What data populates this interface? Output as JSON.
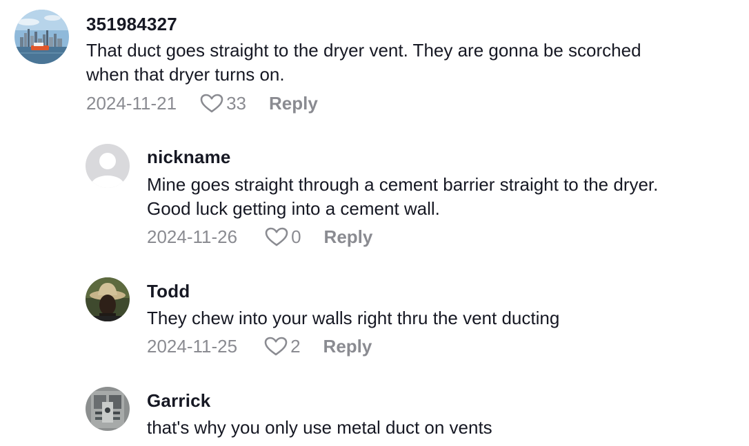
{
  "comments": [
    {
      "username": "351984327",
      "text_lines": [
        "That duct goes straight to the dryer vent. They are gonna be scorched",
        "when that dryer turns on."
      ],
      "date": "2024-11-21",
      "likes": "33",
      "reply_label": "Reply",
      "avatar": "city-skyline-photo"
    },
    {
      "username": "nickname",
      "text_lines": [
        "Mine goes straight through a cement barrier straight to the dryer.",
        "Good luck getting into a cement wall."
      ],
      "date": "2024-11-26",
      "likes": "0",
      "reply_label": "Reply",
      "avatar": "default-user-placeholder"
    },
    {
      "username": "Todd",
      "text_lines": [
        "They chew into your walls right thru the vent ducting"
      ],
      "date": "2024-11-25",
      "likes": "2",
      "reply_label": "Reply",
      "avatar": "person-in-bucket-hat-photo"
    },
    {
      "username": "Garrick",
      "text_lines": [
        "that's why you only use metal duct on vents"
      ],
      "avatar": "electrical-panel-photo"
    }
  ],
  "colors": {
    "primary_text": "#161823",
    "secondary_text": "#8a8b91",
    "background": "#ffffff"
  }
}
